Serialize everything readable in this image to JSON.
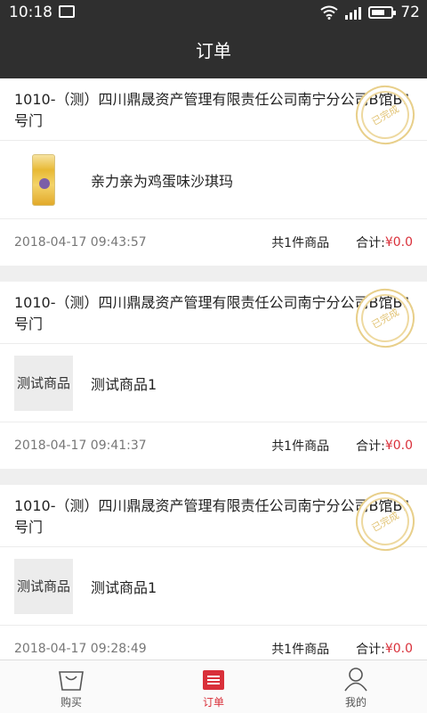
{
  "status": {
    "time": "10:18",
    "battery": "72"
  },
  "header": {
    "title": "订单"
  },
  "orders": [
    {
      "store": "1010-（测）四川鼎晟资产管理有限责任公司南宁分公司B馆B1号门",
      "stamp": "已完成",
      "item_name": "亲力亲为鸡蛋味沙琪玛",
      "date": "2018-04-17 09:43:57",
      "count": "共1件商品",
      "total_label": "合计:",
      "total_amount": "¥0.0"
    },
    {
      "store": "1010-（测）四川鼎晟资产管理有限责任公司南宁分公司B馆B1号门",
      "stamp": "已完成",
      "thumb_text": "测试商品",
      "item_name": "测试商品1",
      "date": "2018-04-17 09:41:37",
      "count": "共1件商品",
      "total_label": "合计:",
      "total_amount": "¥0.0"
    },
    {
      "store": "1010-（测）四川鼎晟资产管理有限责任公司南宁分公司B馆B1号门",
      "stamp": "已完成",
      "thumb_text": "测试商品",
      "item_name": "测试商品1",
      "date": "2018-04-17 09:28:49",
      "count": "共1件商品",
      "total_label": "合计:",
      "total_amount": "¥0.0"
    }
  ],
  "tabs": [
    {
      "label": "购买",
      "icon": "shopping-bag-icon"
    },
    {
      "label": "订单",
      "icon": "order-list-icon",
      "active": true
    },
    {
      "label": "我的",
      "icon": "user-icon"
    }
  ],
  "colors": {
    "bar": "#2f2f2f",
    "accent": "#d9303a",
    "stamp": "#e2c476"
  }
}
